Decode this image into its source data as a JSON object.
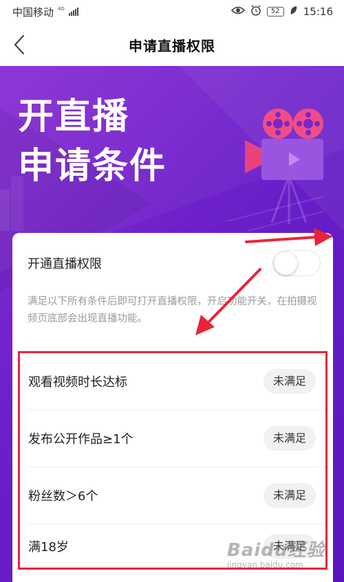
{
  "status_bar": {
    "carrier": "中国移动",
    "net_type": "4G",
    "battery": "52",
    "time": "15:16"
  },
  "nav": {
    "title": "申请直播权限"
  },
  "hero": {
    "line1": "开直播",
    "line2": "申请条件"
  },
  "card": {
    "toggle_label": "开通直播权限",
    "toggle_on": false,
    "description": "满足以下所有条件后即可打开直播权限，开启功能开关，在拍摄视频页底部会出现直播功能。",
    "conditions": [
      {
        "label": "观看视频时长达标",
        "status": "未满足"
      },
      {
        "label": "发布公开作品≥1个",
        "status": "未满足"
      },
      {
        "label": "粉丝数＞6个",
        "status": "未满足"
      },
      {
        "label": "满18岁",
        "status": "未满足"
      }
    ]
  },
  "watermark": {
    "main": "Baidu经验",
    "sub": "jingyan.baidu.com"
  },
  "colors": {
    "accent_purple": "#6a1fc8",
    "annotation_red": "#e8243a"
  }
}
